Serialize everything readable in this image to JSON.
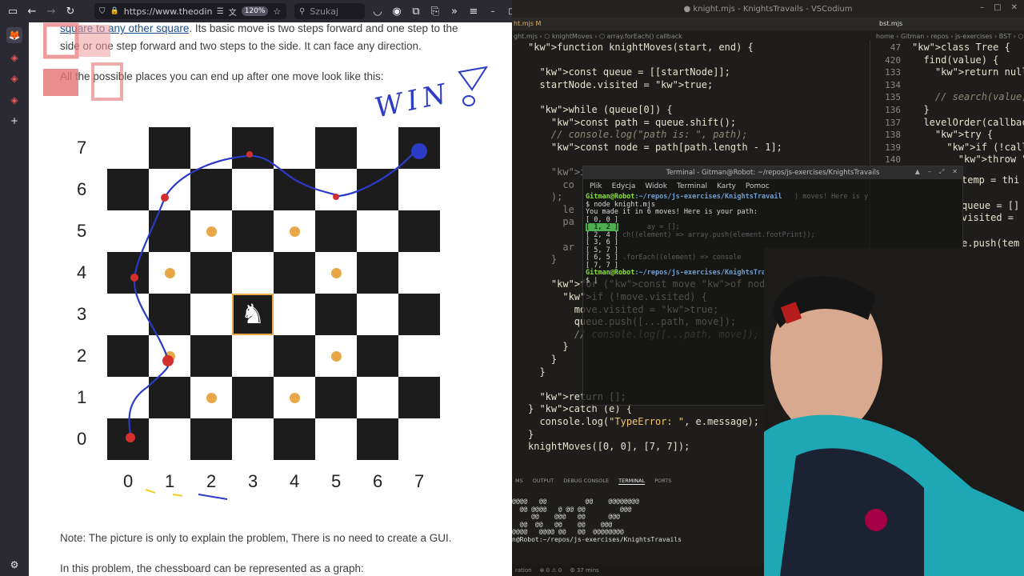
{
  "browser": {
    "url": "https://www.theodinp",
    "zoom": "120%",
    "search_placeholder": "Szukaj",
    "colors": {
      "toolbar": "#2b2a33",
      "link": "#1d4f8c"
    }
  },
  "page": {
    "intro_link": "square to any other square",
    "intro_rest": ". Its basic move is two steps forward and one step to the",
    "intro_line2": "side or one step forward and two steps to the side. It can face any direction.",
    "moves_text": "All the possible places you can end up after one move look like this:",
    "note": "Note: The picture is only to explain the problem, There is no need to create a GUI.",
    "graph_text": "In this problem, the chessboard can be represented as a graph:",
    "board": {
      "rows": [
        "7",
        "6",
        "5",
        "4",
        "3",
        "2",
        "1",
        "0"
      ],
      "cols": [
        "0",
        "1",
        "2",
        "3",
        "4",
        "5",
        "6",
        "7"
      ],
      "knight": [
        3,
        3
      ],
      "moves": [
        [
          2,
          5
        ],
        [
          4,
          5
        ],
        [
          1,
          4
        ],
        [
          5,
          4
        ],
        [
          1,
          2
        ],
        [
          5,
          2
        ],
        [
          2,
          1
        ],
        [
          4,
          1
        ]
      ],
      "colors": {
        "dark": "#1c1c1c",
        "light": "#ffffff",
        "highlight": "#e8a848"
      }
    },
    "annotation_text": "WIN"
  },
  "editor": {
    "title": "● knight.mjs - KnightsTravails - VSCodium",
    "tab_left": "ht.mjs M",
    "tab_right": "bst.mjs",
    "crumbs_left": "ght.mjs › ⬡ knightMoves › ⬡ array.forEach() callback",
    "crumbs_right": "home › Gitman › repos › js-exercises › BST › ⬡ bst.mjs",
    "left_code": [
      {
        "n": "",
        "t": "function knightMoves(start, end) {"
      },
      {
        "n": "",
        "t": ""
      },
      {
        "n": "",
        "t": "  const queue = [[startNode]];"
      },
      {
        "n": "",
        "t": "  startNode.visited = true;"
      },
      {
        "n": "",
        "t": ""
      },
      {
        "n": "",
        "t": "  while (queue[0]) {"
      },
      {
        "n": "",
        "t": "    const path = queue.shift();"
      },
      {
        "n": "",
        "t": "    // console.log(\"path is: \", path);"
      },
      {
        "n": "",
        "t": "    const node = path[path.length - 1];"
      },
      {
        "n": "",
        "t": ""
      },
      {
        "n": "",
        "t": "    if ("
      },
      {
        "n": "",
        "t": "      co"
      },
      {
        "n": "",
        "t": "    );"
      },
      {
        "n": "",
        "t": "      le"
      },
      {
        "n": "",
        "t": "      pa"
      },
      {
        "n": "",
        "t": ""
      },
      {
        "n": "",
        "t": "      ar"
      },
      {
        "n": "",
        "t": "    }"
      },
      {
        "n": "",
        "t": ""
      },
      {
        "n": "",
        "t": "    for (const move of node.moves) {"
      },
      {
        "n": "",
        "t": "      if (!move.visited) {"
      },
      {
        "n": "",
        "t": "        move.visited = true;"
      },
      {
        "n": "",
        "t": "        queue.push([...path, move]);"
      },
      {
        "n": "",
        "t": "        // console.log([...path, move]);"
      },
      {
        "n": "",
        "t": "      }"
      },
      {
        "n": "",
        "t": "    }"
      },
      {
        "n": "",
        "t": "  }"
      },
      {
        "n": "",
        "t": ""
      },
      {
        "n": "",
        "t": "  return [];"
      },
      {
        "n": "",
        "t": "} catch (e) {"
      },
      {
        "n": "",
        "t": "  console.log(\"TypeError: \", e.message);"
      },
      {
        "n": "",
        "t": "}"
      },
      {
        "n": "",
        "t": "knightMoves([0, 0], [7, 7]);"
      }
    ],
    "right_code": [
      {
        "n": "47",
        "t": "class Tree {"
      },
      {
        "n": "420",
        "t": "  find(value) {"
      },
      {
        "n": "133",
        "t": "    return null;"
      },
      {
        "n": "134",
        "t": ""
      },
      {
        "n": "135",
        "t": "    // search(value,"
      },
      {
        "n": "136",
        "t": "  }"
      },
      {
        "n": "137",
        "t": "  levelOrder(callbac"
      },
      {
        "n": "138",
        "t": "    try {"
      },
      {
        "n": "139",
        "t": "      if (!callback)"
      },
      {
        "n": "140",
        "t": "        throw new Ty"
      }
    ],
    "right_code_under": [
      "temp = thi",
      "queue = []",
      "visited =",
      "e.push(tem"
    ],
    "terminal": {
      "title": "Terminal - Gitman@Robot: ~/repos/js-exercises/KnightsTravails",
      "menu": [
        "Plik",
        "Edycja",
        "Widok",
        "Terminal",
        "Karty",
        "Pomoc"
      ],
      "user": "Gitman@Robot",
      "path": ":~/repos/js-exercises/KnightsTravail",
      "cmd": "$ node knight.mjs",
      "result": "You made it in 6 moves! Here is your path:",
      "path_lines": [
        "[ 0, 0 ]",
        "[ 1, 2 ]",
        "[ 2, 4 ]",
        "[ 3, 6 ]",
        "[ 5, 7 ]",
        "[ 6, 5 ]",
        "[ 7, 7 ]"
      ],
      "bg_code_1": ") moves! Here is y",
      "bg_code_2": "ay = [];",
      "bg_code_3": "ch((element) => array.push(element.footPrint));",
      "bg_code_4": ".forEach((element) => console",
      "prompt_end": "$ |"
    },
    "panel_tabs": [
      "MS",
      "OUTPUT",
      "DEBUG CONSOLE",
      "TERMINAL",
      "PORTS"
    ],
    "panel_output": [
      "@@@@   @@          @@    @@@@@@@@",
      "  @@ @@@@   @ @@ @@         @@@",
      "     @@    @@@   @@      @@@",
      "  @@  @@   @@    @@    @@@",
      "@@@@   @@@@ @@   @@  @@@@@@@@",
      "n@Robot:~/repos/js-exercises/KnightsTravails"
    ],
    "status": [
      "ration",
      "⊗ 0 ⚠ 0",
      "⚙ 37 mins"
    ]
  }
}
